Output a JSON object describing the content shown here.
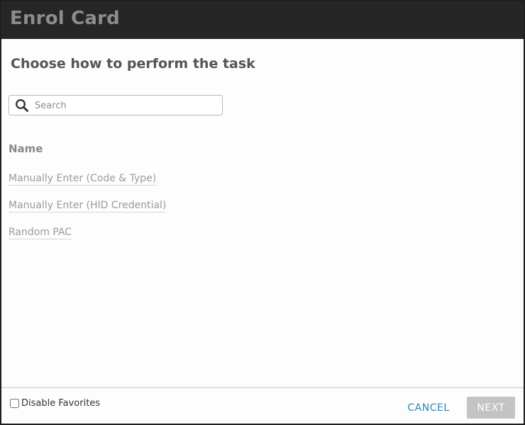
{
  "dialog": {
    "title": "Enrol Card",
    "heading": "Choose how to perform the task"
  },
  "search": {
    "placeholder": "Search",
    "value": ""
  },
  "list": {
    "column_header": "Name",
    "items": [
      {
        "label": "Manually Enter (Code & Type)"
      },
      {
        "label": "Manually Enter (HID Credential)"
      },
      {
        "label": "Random PAC"
      }
    ]
  },
  "footer": {
    "disable_favorites_label": "Disable Favorites",
    "disable_favorites_checked": false,
    "cancel_label": "CANCEL",
    "next_label": "NEXT"
  },
  "colors": {
    "titlebar_bg": "#262626",
    "title_text": "#8c8c8c",
    "cancel_text": "#2e86b8",
    "next_disabled_bg": "#c3c3c3"
  },
  "icons": {
    "search": "search-icon"
  }
}
